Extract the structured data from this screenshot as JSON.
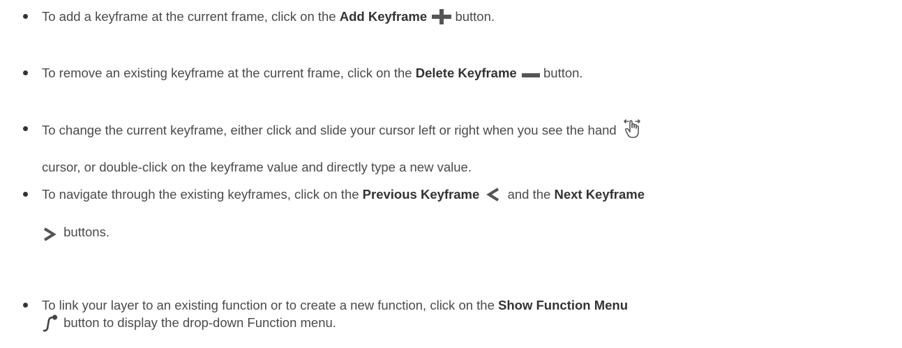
{
  "items": [
    {
      "pre": "To add a keyframe at the current frame, click on the ",
      "bold": "Add Keyframe",
      "post": " button.",
      "icon": "plus-icon"
    },
    {
      "pre": "To remove an existing keyframe at the current frame, click on the ",
      "bold": "Delete Keyframe",
      "post": " button.",
      "icon": "minus-icon"
    },
    {
      "line1": "To change the current keyframe, either click and slide your cursor left or right when you see the hand",
      "line2": "cursor, or double-click on the keyframe value and directly type a new value.",
      "icon": "hand-cursor-icon"
    },
    {
      "pre": "To navigate through the existing keyframes, click on the ",
      "bold1": "Previous Keyframe",
      "mid": " and the ",
      "bold2": "Next Keyframe",
      "post": " buttons.",
      "icon1": "chevron-left-icon",
      "icon2": "chevron-right-icon"
    },
    {
      "pre": "To link your layer to an existing function or to create a new function, click on the ",
      "bold": "Show Function Menu",
      "post": " button to display the drop-down Function menu.",
      "icon": "function-curve-icon"
    }
  ]
}
